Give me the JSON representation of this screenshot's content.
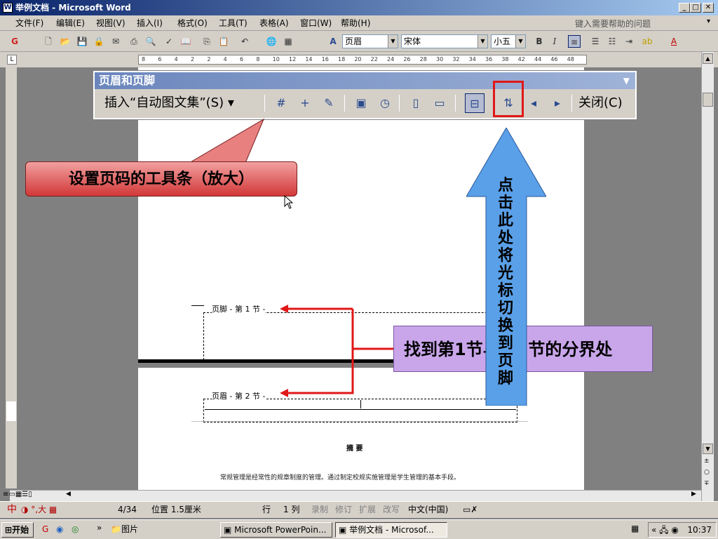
{
  "window": {
    "title": "举例文档 - Microsoft Word",
    "app_icon": "word-icon"
  },
  "menu": {
    "items": [
      "文件(F)",
      "编辑(E)",
      "视图(V)",
      "插入(I)",
      "格式(O)",
      "工具(T)",
      "表格(A)",
      "窗口(W)",
      "帮助(H)"
    ],
    "help_placeholder": "键入需要帮助的问题"
  },
  "toolbar": {
    "style": "页眉",
    "font": "宋体",
    "size": "小五",
    "bold": "B",
    "italic": "I"
  },
  "ruler": {
    "ticks": [
      "8",
      "6",
      "4",
      "2",
      "2",
      "4",
      "6",
      "8",
      "10",
      "12",
      "14",
      "16",
      "18",
      "20",
      "22",
      "24",
      "26",
      "28",
      "30",
      "32",
      "34",
      "36",
      "38",
      "42",
      "44",
      "46",
      "48"
    ]
  },
  "hf_toolbar": {
    "title": "页眉和页脚",
    "insert_autotext": "插入“自动图文集”(S) ▾",
    "close": "关闭(C)"
  },
  "callouts": {
    "toolbar_zoom": "设置页码的工具条（放大）",
    "find_boundary": "找到第1节与第2节的分界处",
    "switch": "点击此处将光标切换到页脚"
  },
  "document": {
    "footer_label": "页脚 - 第 1 节 -",
    "header_label": "页眉 - 第 2 节 -",
    "abstract_title": "摘 要",
    "body_line": "常规管理是经常性的规章制度的管理。通过制定校规实施管理是学生管理的基本手段。"
  },
  "status": {
    "page": "4/34",
    "position": "位置 1.5厘米",
    "row": "行",
    "col": "1 列",
    "rec": "录制",
    "trk": "修订",
    "ext": "扩展",
    "ovr": "改写",
    "lang": "中文(中国)",
    "ime": "中"
  },
  "taskbar": {
    "start": "开始",
    "folder": "图片",
    "ppt": "Microsoft PowerPoin...",
    "word": "举例文档 - Microsof...",
    "time": "10:37"
  },
  "colors": {
    "accent_red": "#e01818",
    "callout_purple": "#c9a6ea",
    "arrow_blue": "#5aa0e8"
  }
}
